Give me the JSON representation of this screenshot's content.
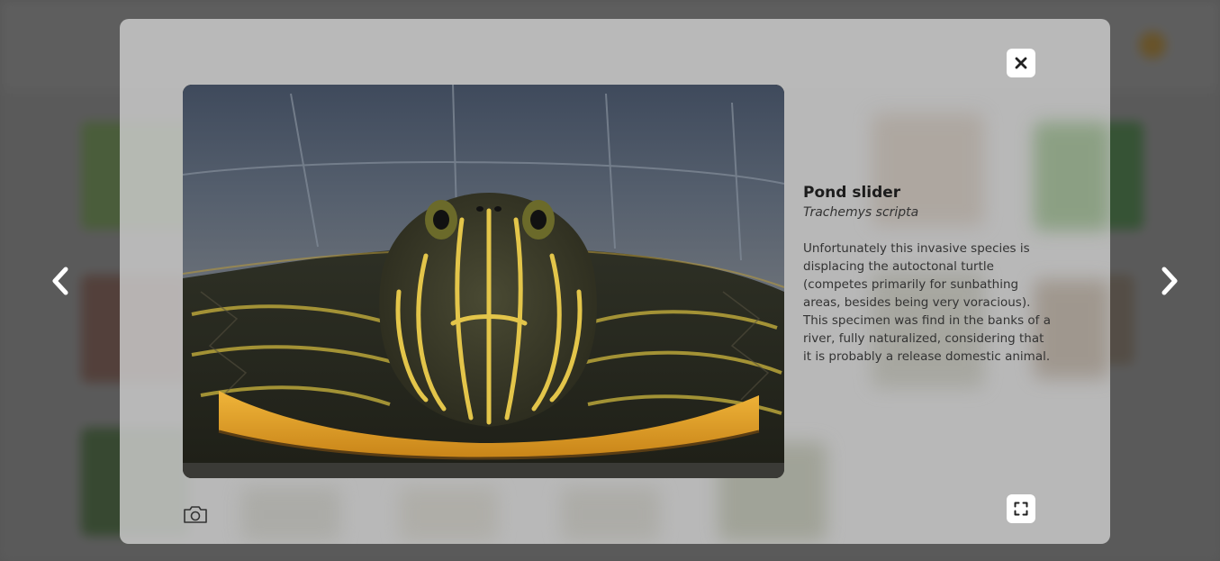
{
  "species": {
    "common_name": "Pond slider",
    "scientific_name": "Trachemys scripta",
    "description": "Unfortunately this invasive species is displacing the autoctonal turtle (competes primarily for sunbathing areas, besides being very voracious). This specimen was find in the banks of a river, fully naturalized, considering that it is probably a release domestic animal."
  },
  "photo": {
    "subject": "Pond slider turtle head close-up"
  },
  "icons": {
    "close": "close-icon",
    "fullscreen": "fullscreen-icon",
    "camera": "camera-icon",
    "prev": "chevron-left-icon",
    "next": "chevron-right-icon"
  },
  "colors": {
    "modal_bg": "#cdcdcd",
    "button_bg": "#ffffff",
    "arrow": "#ffffff"
  }
}
